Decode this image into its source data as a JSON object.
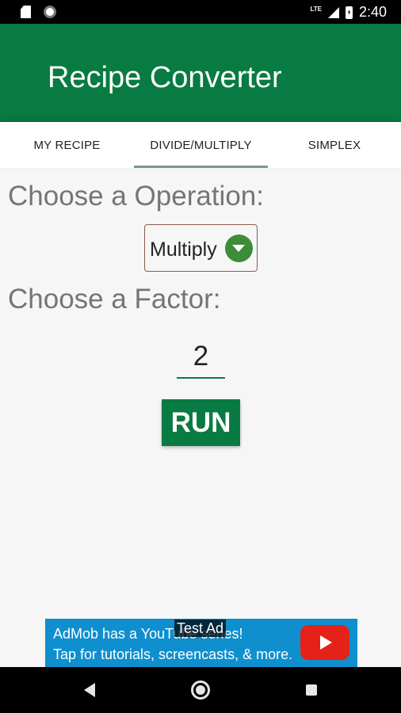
{
  "status_bar": {
    "icons": [
      "sd-card-icon",
      "notification-dot-icon",
      "lte-icon",
      "signal-icon",
      "battery-charging-icon"
    ],
    "network_label": "LTE",
    "time": "2:40"
  },
  "app_bar": {
    "title": "Recipe Converter",
    "color": "#087b42"
  },
  "tabs": [
    {
      "label": "MY RECIPE",
      "selected": false
    },
    {
      "label": "DIVIDE/MULTIPLY",
      "selected": true
    },
    {
      "label": "SIMPLEX",
      "selected": false
    }
  ],
  "main": {
    "operation_label": "Choose a Operation:",
    "operation_value": "Multiply",
    "factor_label": "Choose a Factor:",
    "factor_value": "2",
    "run_label": "RUN"
  },
  "ad": {
    "line1": "AdMob has a YouTube series!",
    "line2": "Tap for tutorials, screencasts, & more.",
    "tag": "Test Ad",
    "icon": "youtube-play-icon",
    "background": "#0f8fce"
  },
  "nav_bar": {
    "icons": [
      "back-icon",
      "home-icon",
      "recents-icon"
    ]
  }
}
